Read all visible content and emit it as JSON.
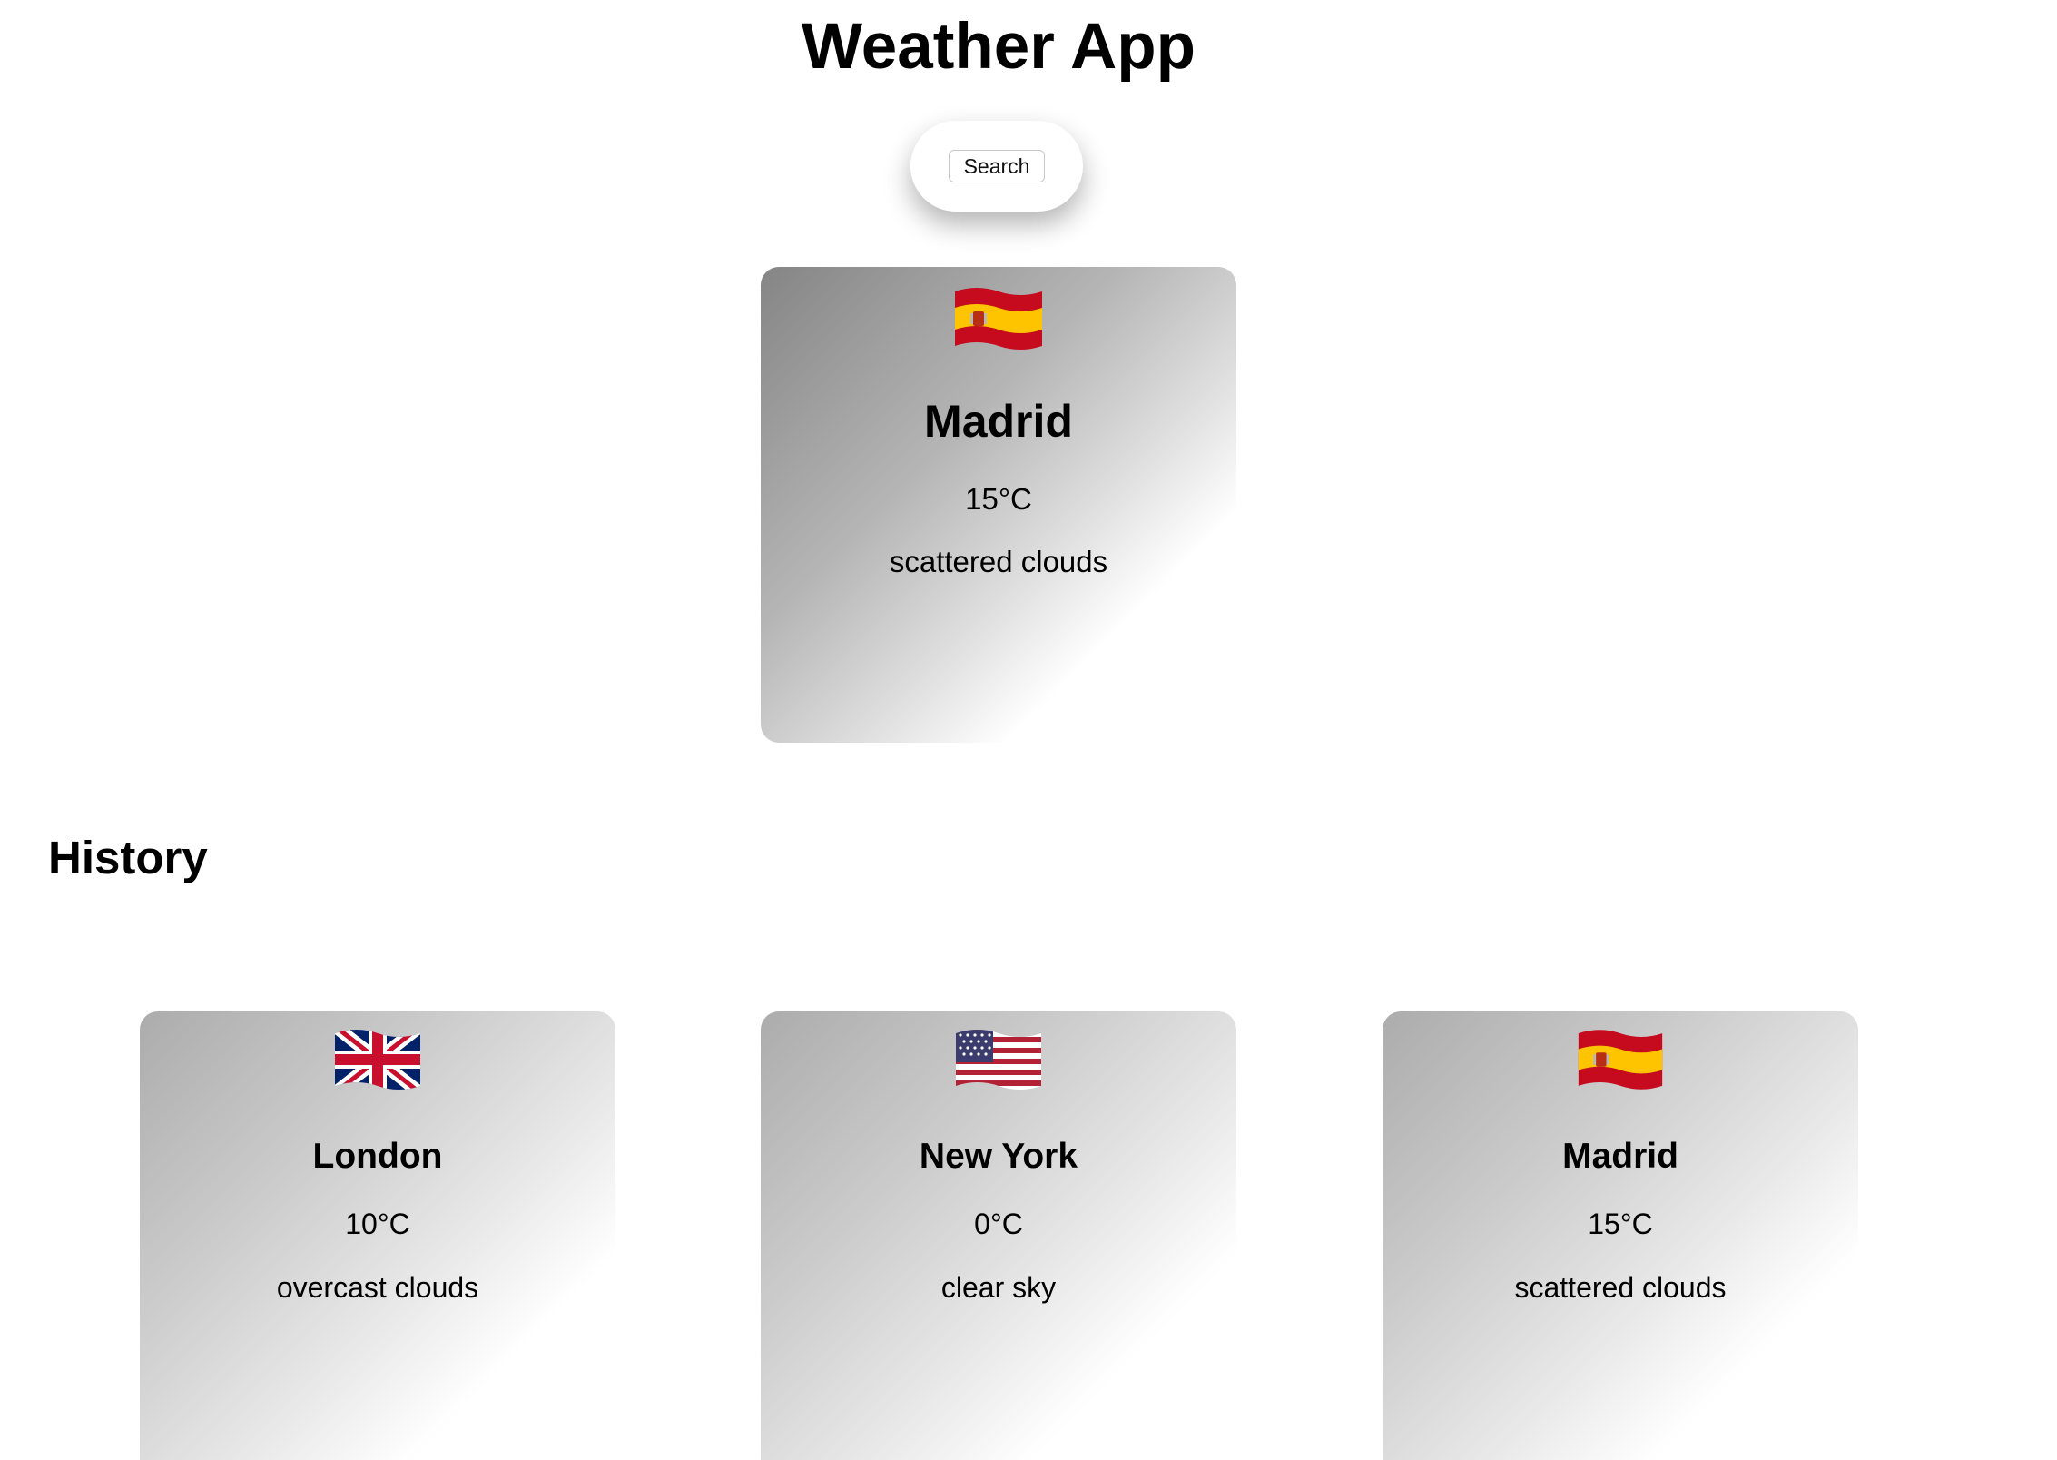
{
  "header": {
    "title": "Weather App"
  },
  "search": {
    "button_label": "Search"
  },
  "current": {
    "flag_icon": "spain-flag-icon",
    "city": "Madrid",
    "temperature": "15°C",
    "description": "scattered clouds"
  },
  "history": {
    "title": "History",
    "items": [
      {
        "flag_icon": "uk-flag-icon",
        "city": "London",
        "temperature": "10°C",
        "description": "overcast clouds"
      },
      {
        "flag_icon": "usa-flag-icon",
        "city": "New York",
        "temperature": "0°C",
        "description": "clear sky"
      },
      {
        "flag_icon": "spain-flag-icon",
        "city": "Madrid",
        "temperature": "15°C",
        "description": "scattered clouds"
      }
    ]
  },
  "colors": {
    "spain_red": "#c60b1e",
    "spain_yellow": "#ffc400",
    "uk_blue": "#012169",
    "uk_red": "#c8102e",
    "usa_red": "#b22234",
    "usa_blue": "#3c3b6e"
  }
}
